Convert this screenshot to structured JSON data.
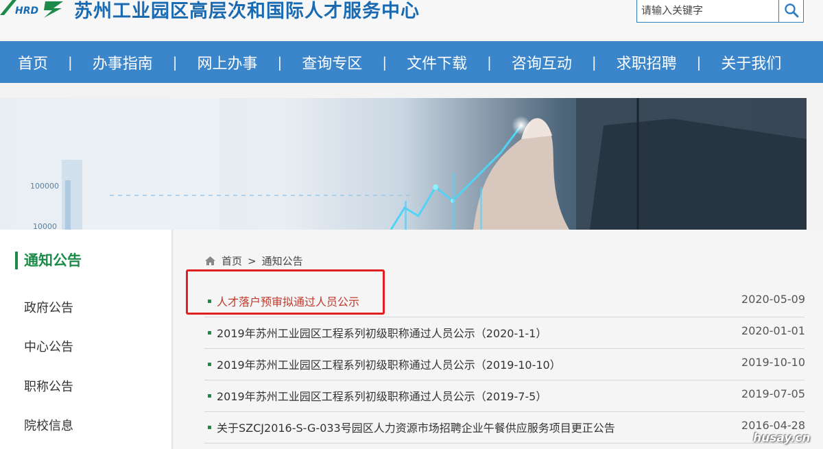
{
  "header": {
    "logo_text": "HRD",
    "site_title": "苏州工业园区高层次和国际人才服务中心",
    "search_placeholder": "请输入关键字",
    "search_icon": "search-icon"
  },
  "nav": {
    "items": [
      "首页",
      "办事指南",
      "网上办事",
      "查询专区",
      "文件下载",
      "咨询互动",
      "求职招聘",
      "关于我们"
    ],
    "separator": "|"
  },
  "banner": {
    "labels": [
      "100000",
      "10000"
    ]
  },
  "sidebar": {
    "title": "通知公告",
    "items": [
      "政府公告",
      "中心公告",
      "职称公告",
      "院校信息"
    ]
  },
  "breadcrumb": {
    "home_icon": "home-icon",
    "home": "首页",
    "separator": ">",
    "current": "通知公告"
  },
  "news": [
    {
      "title": "人才落户预审拟通过人员公示",
      "date": "2020-05-09"
    },
    {
      "title": "2019年苏州工业园区工程系列初级职称通过人员公示（2020-1-1）",
      "date": "2020-01-01"
    },
    {
      "title": "2019年苏州工业园区工程系列初级职称通过人员公示（2019-10-10）",
      "date": "2019-10-10"
    },
    {
      "title": "2019年苏州工业园区工程系列初级职称通过人员公示（2019-7-5）",
      "date": "2019-07-05"
    },
    {
      "title": "关于SZCJ2016-S-G-033号园区人力资源市场招聘企业午餐供应服务项目更正公告",
      "date": "2016-04-28"
    }
  ],
  "watermark": "husay.cn",
  "colors": {
    "brand_blue": "#3b86cb",
    "title_blue": "#1a6ab1",
    "green": "#1c8a48",
    "highlight_red": "#c0392b",
    "annotation_red": "#e02020"
  }
}
